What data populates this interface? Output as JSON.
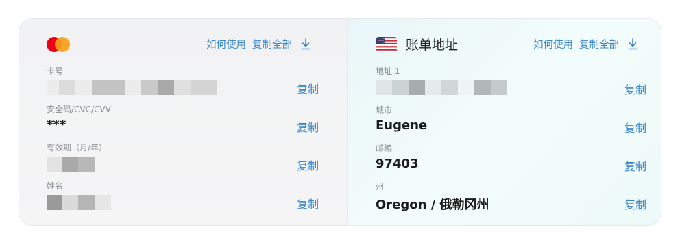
{
  "card": {
    "brand_icon": "mastercard-logo",
    "how_to_use": "如何使用",
    "copy_all": "复制全部",
    "fields": [
      {
        "label": "卡号",
        "value": "",
        "masked": true,
        "copy": "复制"
      },
      {
        "label": "安全码/CVC/CVV",
        "value": "***",
        "masked": false,
        "copy": "复制"
      },
      {
        "label": "有效期（月/年）",
        "value": "",
        "masked": true,
        "copy": "复制"
      },
      {
        "label": "姓名",
        "value": "",
        "masked": true,
        "copy": "复制"
      }
    ]
  },
  "billing": {
    "flag_icon": "us-flag-icon",
    "title": "账单地址",
    "how_to_use": "如何使用",
    "copy_all": "复制全部",
    "fields": [
      {
        "label": "地址 1",
        "value": "",
        "masked": true,
        "copy": "复制"
      },
      {
        "label": "城市",
        "value": "Eugene",
        "masked": false,
        "copy": "复制"
      },
      {
        "label": "邮编",
        "value": "97403",
        "masked": false,
        "copy": "复制"
      },
      {
        "label": "州",
        "value": "Oregon / 俄勒冈州",
        "masked": false,
        "copy": "复制"
      }
    ]
  },
  "colors": {
    "link": "#3a86c8",
    "mc_red": "#eb001b",
    "mc_orange": "#f79e1b"
  }
}
